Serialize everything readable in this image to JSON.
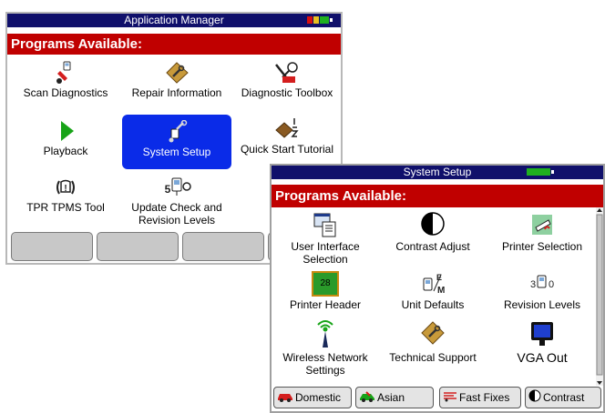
{
  "app_manager": {
    "title": "Application Manager",
    "header": "Programs Available:",
    "programs": [
      {
        "label": "Scan Diagnostics"
      },
      {
        "label": "Repair Information"
      },
      {
        "label": "Diagnostic Toolbox"
      },
      {
        "label": "Playback"
      },
      {
        "label": "System Setup"
      },
      {
        "label": "Quick Start Tutorial"
      },
      {
        "label": "TPR TPMS Tool"
      },
      {
        "label": "Update Check and Revision Levels"
      }
    ],
    "unit_badge": "5",
    "colors": {
      "title_bg": "#10106b",
      "header_bg": "#c00000",
      "selected_bg": "#0a2be8"
    }
  },
  "system_setup": {
    "title": "System Setup",
    "header": "Programs Available:",
    "programs": [
      {
        "label": "User Interface Selection"
      },
      {
        "label": "Contrast Adjust"
      },
      {
        "label": "Printer Selection"
      },
      {
        "label": "Printer Header"
      },
      {
        "label": "Unit Defaults"
      },
      {
        "label": "Revision Levels"
      },
      {
        "label": "Wireless Network Settings"
      },
      {
        "label": "Technical Support"
      },
      {
        "label": "VGA Out"
      }
    ],
    "printer_header_badge": "28",
    "unit_defaults_badge_top": "E",
    "unit_defaults_badge_bottom": "M",
    "revision_badge_left": "3",
    "revision_badge_right": "0",
    "buttons": [
      {
        "label": "Domestic"
      },
      {
        "label": "Asian"
      },
      {
        "label": "Fast Fixes"
      },
      {
        "label": "Contrast"
      }
    ]
  }
}
